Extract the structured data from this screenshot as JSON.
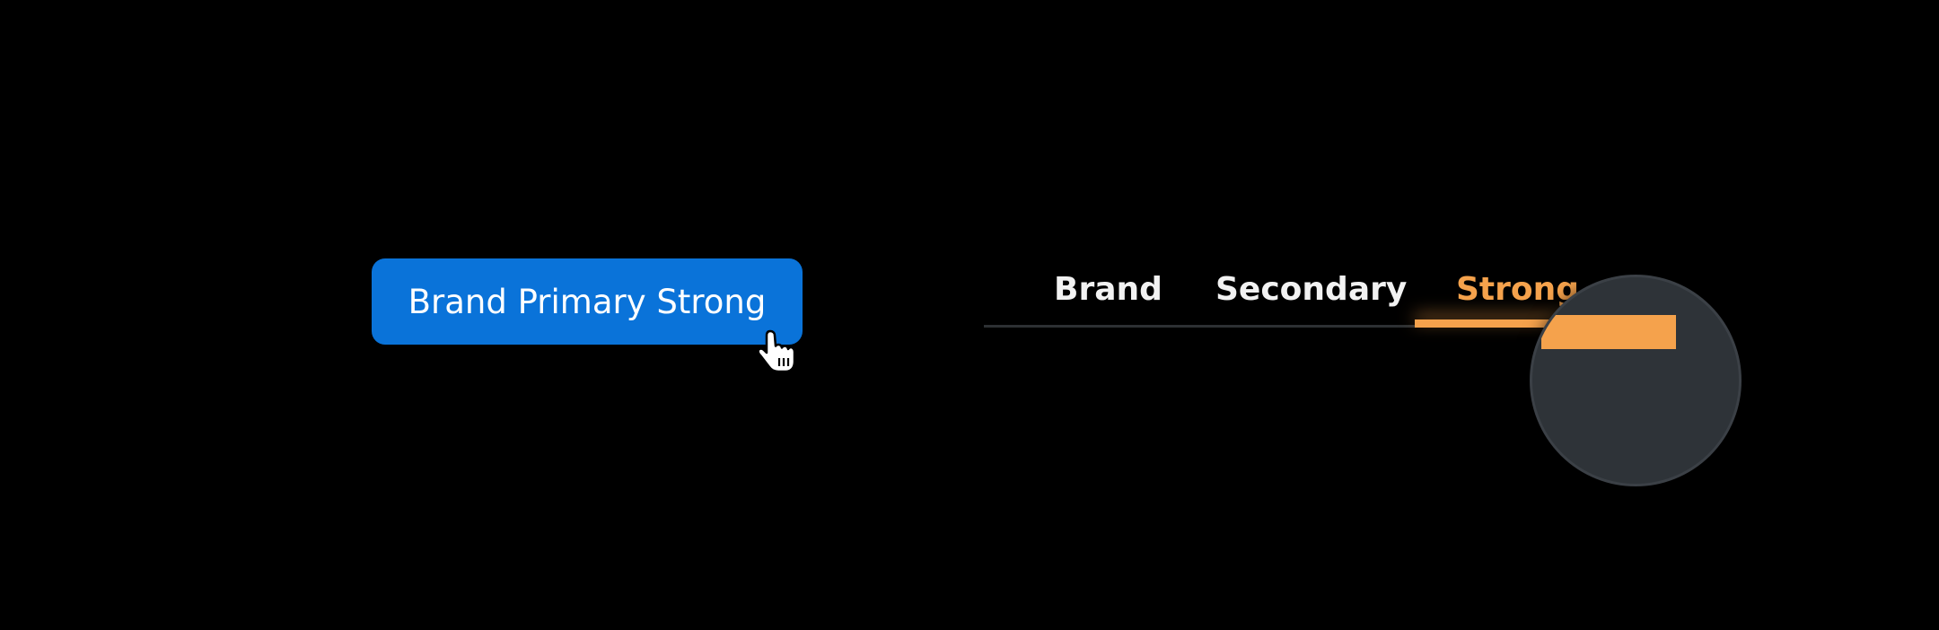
{
  "primary_button": {
    "label": "Brand Primary Strong",
    "color": "#0a73d9"
  },
  "cursor": {
    "icon": "hand-pointer-icon"
  },
  "tabs": {
    "items": [
      {
        "label": "Brand",
        "active": false
      },
      {
        "label": "Secondary",
        "active": false
      },
      {
        "label": "Strong",
        "active": true
      }
    ],
    "active_color": "#f5a24c",
    "inactive_color": "#f2f2f2"
  },
  "magnifier": {
    "icon": "magnifier-lens-icon"
  }
}
